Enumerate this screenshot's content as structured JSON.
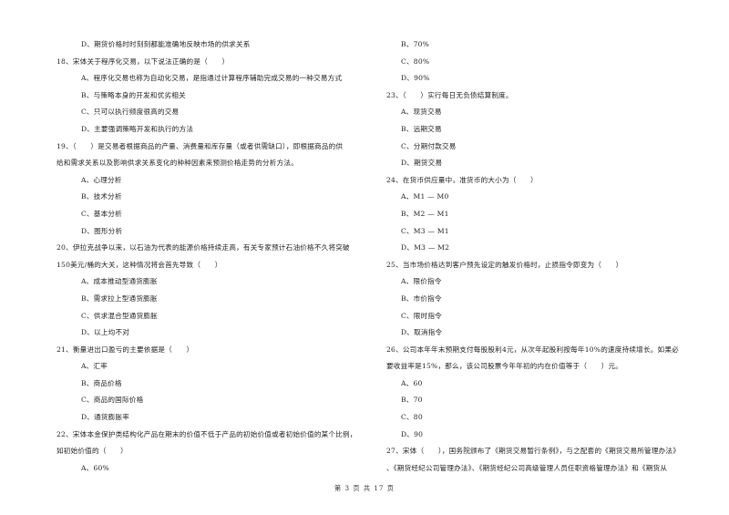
{
  "left_column": [
    {
      "type": "option",
      "text": "D、期货价格时时刻刻都能准确地反映市场的供求关系"
    },
    {
      "type": "question",
      "text": "18、宋体关于程序化交易，以下说法正确的是（　　）"
    },
    {
      "type": "option",
      "text": "A、程序化交易也称为自动化交易，是指通过计算程序辅助完成交易的一种交易方式"
    },
    {
      "type": "option",
      "text": "B、与策略本身的开发和优劣相关"
    },
    {
      "type": "option",
      "text": "C、只可以执行频度很高的交易"
    },
    {
      "type": "option",
      "text": "D、主要强调策略开发和执行的方法"
    },
    {
      "type": "question",
      "text": "19、（　　）是交易者根据商品的产量、消费量和库存量（或者供需缺口），即根据商品的供"
    },
    {
      "type": "question",
      "text": "给和需求关系以及影响供求关系变化的种种因素来预测价格走势的分析方法。"
    },
    {
      "type": "option",
      "text": "A、心理分析"
    },
    {
      "type": "option",
      "text": "B、技术分析"
    },
    {
      "type": "option",
      "text": "C、基本分析"
    },
    {
      "type": "option",
      "text": "D、图形分析"
    },
    {
      "type": "question",
      "text": "20、伊拉克战争以来，以石油为代表的能源价格持续走高，有关专家预计石油价格不久将突破"
    },
    {
      "type": "question",
      "text": "150美元/桶的大关，这种情况将会首先导致（　　）"
    },
    {
      "type": "option",
      "text": "A、成本推动型通货膨胀"
    },
    {
      "type": "option",
      "text": "B、需求拉上型通货膨胀"
    },
    {
      "type": "option",
      "text": "C、供求混合型通货膨胀"
    },
    {
      "type": "option",
      "text": "D、以上均不对"
    },
    {
      "type": "question",
      "text": "21、衡量进出口盈亏的主要依据是（　　）"
    },
    {
      "type": "option",
      "text": "A、汇率"
    },
    {
      "type": "option",
      "text": "B、商品价格"
    },
    {
      "type": "option",
      "text": "C、商品的国际价格"
    },
    {
      "type": "option",
      "text": "D、通货膨胀率"
    },
    {
      "type": "question",
      "text": "22、宋体本金保护类结构化产品在期末的价值不低于产品的初始价值或者初始价值的某个比例，"
    },
    {
      "type": "question",
      "text": "如初始价值的（　　）"
    },
    {
      "type": "option",
      "text": "A、60%"
    }
  ],
  "right_column": [
    {
      "type": "option",
      "text": "B、70%"
    },
    {
      "type": "option",
      "text": "C、80%"
    },
    {
      "type": "option",
      "text": "D、90%"
    },
    {
      "type": "question",
      "text": "23、（　　）实行每日无负债结算制度。"
    },
    {
      "type": "option",
      "text": "A、现货交易"
    },
    {
      "type": "option",
      "text": "B、远期交易"
    },
    {
      "type": "option",
      "text": "C、分期付款交易"
    },
    {
      "type": "option",
      "text": "D、期货交易"
    },
    {
      "type": "question",
      "text": "24、在货币供应量中，准货币的大小为（　　）"
    },
    {
      "type": "option",
      "text": "A、M1 — M0"
    },
    {
      "type": "option",
      "text": "B、M2 — M1"
    },
    {
      "type": "option",
      "text": "C、M3 — M1"
    },
    {
      "type": "option",
      "text": "D、M3 — M2"
    },
    {
      "type": "question",
      "text": "25、当市场价格达到客户预先设定的触发价格时，止损指令即变为（　　）"
    },
    {
      "type": "option",
      "text": "A、限价指令"
    },
    {
      "type": "option",
      "text": "B、市价指令"
    },
    {
      "type": "option",
      "text": "C、限时指令"
    },
    {
      "type": "option",
      "text": "D、取消指令"
    },
    {
      "type": "question",
      "text": "26、公司本年年末预期支付每股股利4元，从次年起股利按每年10%的速度持续增长。如果必"
    },
    {
      "type": "question",
      "text": "要收益率是15%，那么，该公司股票今年年初的内在价值等于（　　）元。"
    },
    {
      "type": "option",
      "text": "A、60"
    },
    {
      "type": "option",
      "text": "B、70"
    },
    {
      "type": "option",
      "text": "C、80"
    },
    {
      "type": "option",
      "text": "D、90"
    },
    {
      "type": "question",
      "text": "27、宋体（　　），国务院颁布了《期货交易暂行条例》，与之配套的《期货交易所管理办法》"
    },
    {
      "type": "question",
      "text": "、《期货经纪公司管理办法》、《期货经纪公司高级管理人员任职资格管理办法》和《期货从"
    }
  ],
  "footer": {
    "page_label": "第 3 页 共 17 页"
  }
}
